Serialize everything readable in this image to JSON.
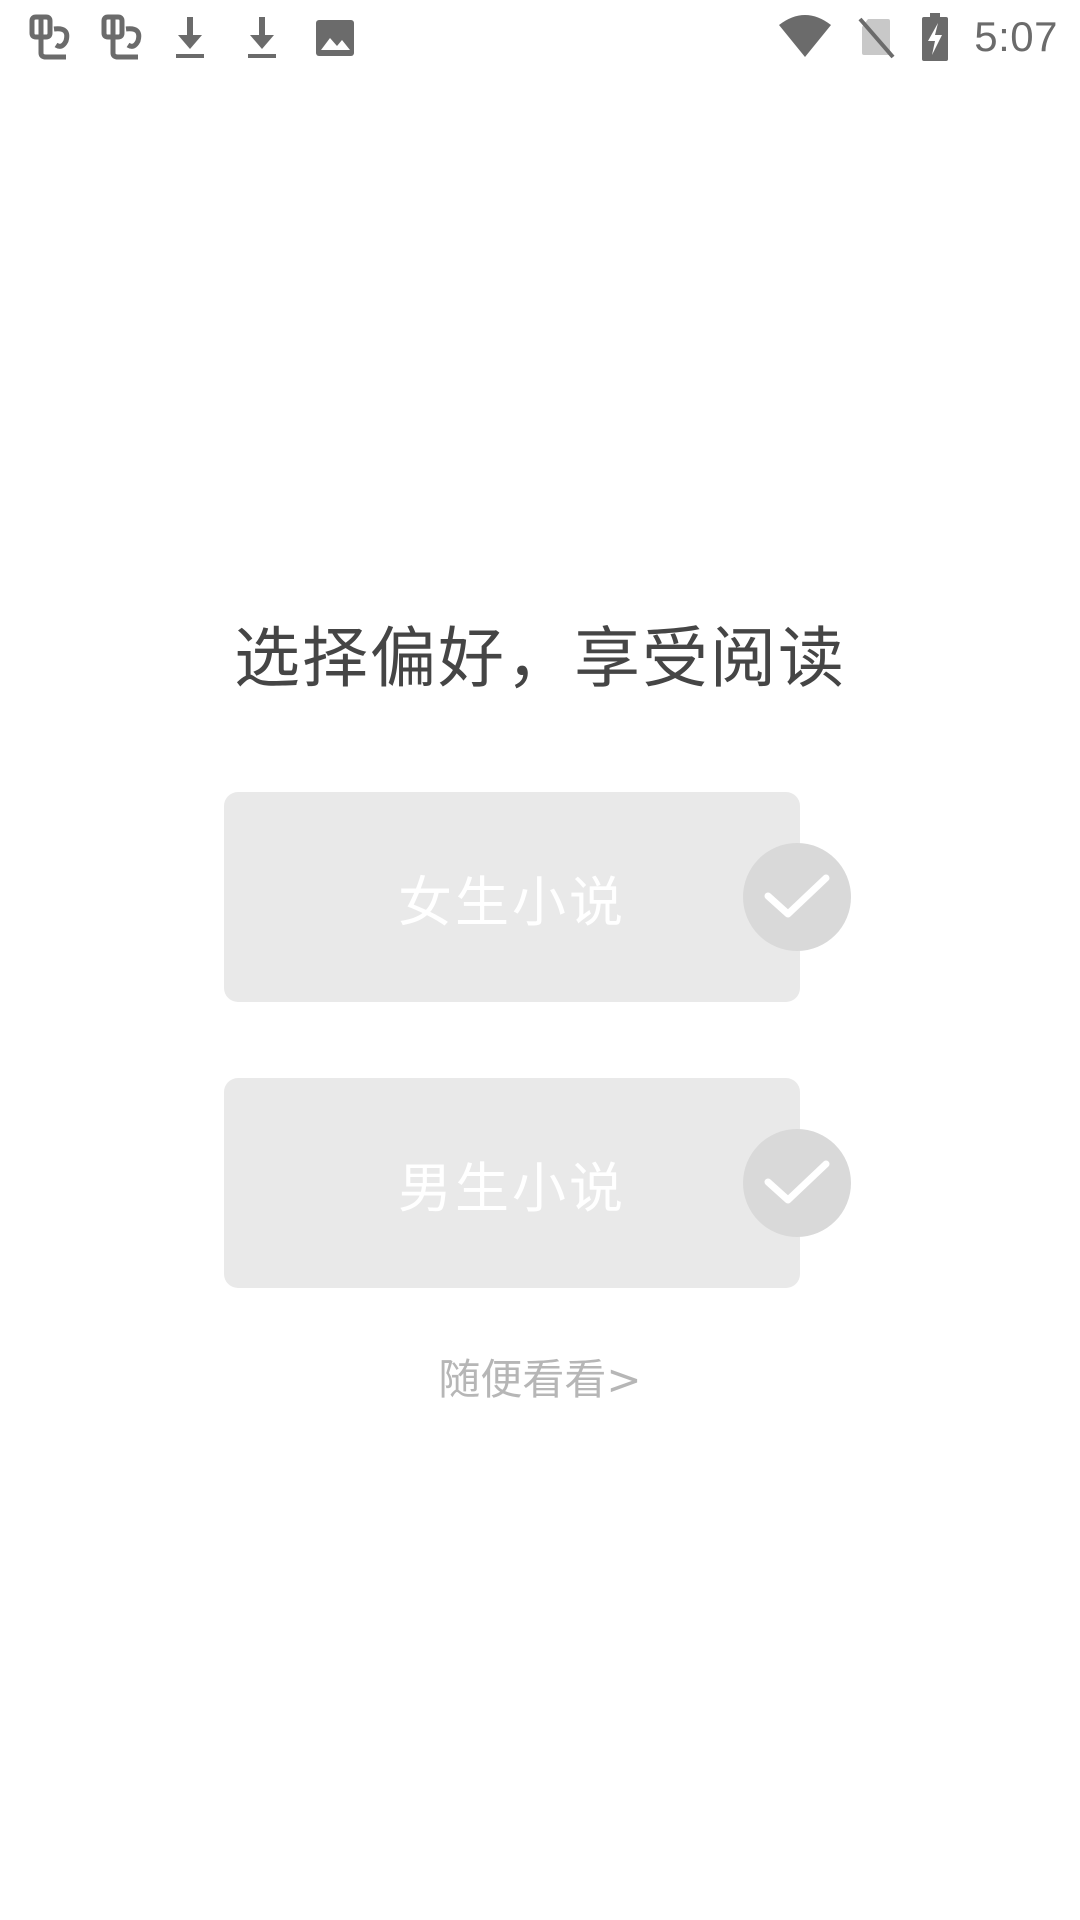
{
  "status_bar": {
    "time": "5:07",
    "left_icons": [
      "bug-icon",
      "bug-icon",
      "download-icon",
      "download-icon",
      "image-icon"
    ],
    "right_icons": [
      "wifi-icon",
      "no-sim-icon",
      "battery-charging-icon"
    ],
    "icon_color": "#6b6b6b"
  },
  "page": {
    "title": "选择偏好，享受阅读",
    "options": [
      {
        "label": "女生小说",
        "selected": false
      },
      {
        "label": "男生小说",
        "selected": false
      }
    ],
    "skip_label": "随便看看>"
  },
  "colors": {
    "card_background": "#e9e9e9",
    "check_background": "#d9d9d9",
    "title_text": "#454545",
    "skip_text": "#b6b6b6"
  }
}
